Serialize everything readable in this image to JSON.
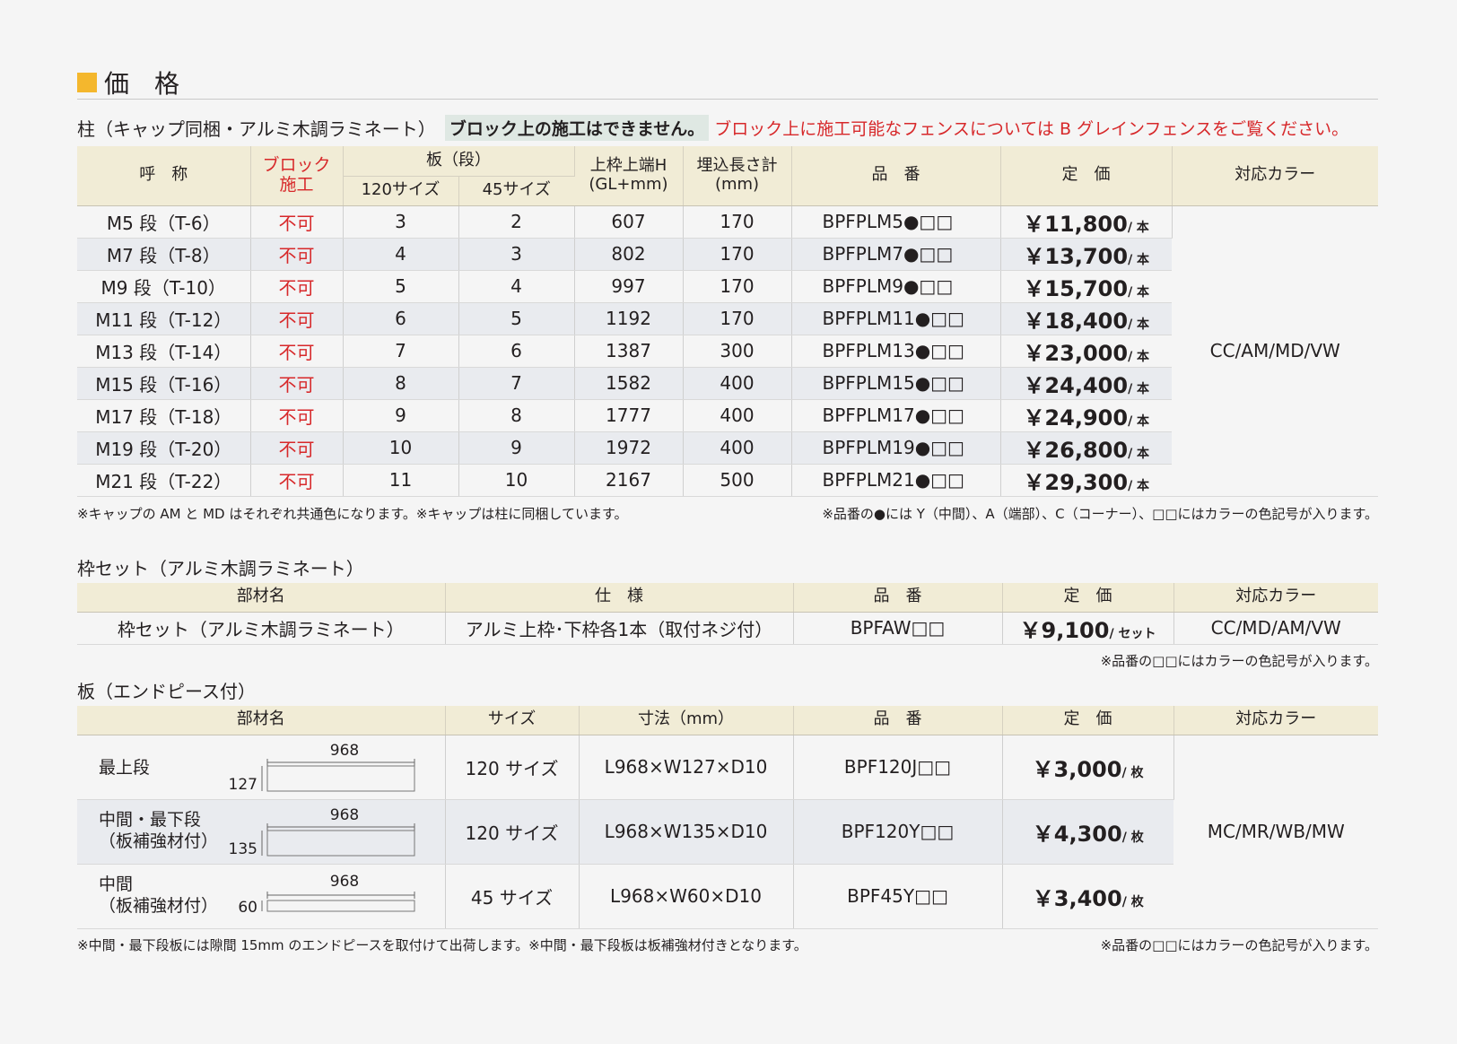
{
  "section_title": "価　格",
  "posts": {
    "heading": "柱（キャップ同梱・アルミ木調ラミネート）",
    "notice": "ブロック上の施工はできません。",
    "notice_red": "ブロック上に施工可能なフェンスについては B グレインフェンスをご覧ください。",
    "headers": {
      "name": "呼　称",
      "block": "ブロック\n施工",
      "plates": "板（段）",
      "size120": "120サイズ",
      "size45": "45サイズ",
      "height": "上枠上端H\n(GL+mm)",
      "bury": "埋込長さ計\n(mm)",
      "code": "品　番",
      "price": "定　価",
      "color": "対応カラー"
    },
    "rows": [
      {
        "name": "M5 段（T-6）",
        "block": "不可",
        "s120": "3",
        "s45": "2",
        "h": "607",
        "bury": "170",
        "code": "BPFPLM5●□□",
        "price": "￥11,800",
        "unit": "/ 本"
      },
      {
        "name": "M7 段（T-8）",
        "block": "不可",
        "s120": "4",
        "s45": "3",
        "h": "802",
        "bury": "170",
        "code": "BPFPLM7●□□",
        "price": "￥13,700",
        "unit": "/ 本"
      },
      {
        "name": "M9 段（T-10）",
        "block": "不可",
        "s120": "5",
        "s45": "4",
        "h": "997",
        "bury": "170",
        "code": "BPFPLM9●□□",
        "price": "￥15,700",
        "unit": "/ 本"
      },
      {
        "name": "M11 段（T-12）",
        "block": "不可",
        "s120": "6",
        "s45": "5",
        "h": "1192",
        "bury": "170",
        "code": "BPFPLM11●□□",
        "price": "￥18,400",
        "unit": "/ 本"
      },
      {
        "name": "M13 段（T-14）",
        "block": "不可",
        "s120": "7",
        "s45": "6",
        "h": "1387",
        "bury": "300",
        "code": "BPFPLM13●□□",
        "price": "￥23,000",
        "unit": "/ 本"
      },
      {
        "name": "M15 段（T-16）",
        "block": "不可",
        "s120": "8",
        "s45": "7",
        "h": "1582",
        "bury": "400",
        "code": "BPFPLM15●□□",
        "price": "￥24,400",
        "unit": "/ 本"
      },
      {
        "name": "M17 段（T-18）",
        "block": "不可",
        "s120": "9",
        "s45": "8",
        "h": "1777",
        "bury": "400",
        "code": "BPFPLM17●□□",
        "price": "￥24,900",
        "unit": "/ 本"
      },
      {
        "name": "M19 段（T-20）",
        "block": "不可",
        "s120": "10",
        "s45": "9",
        "h": "1972",
        "bury": "400",
        "code": "BPFPLM19●□□",
        "price": "￥26,800",
        "unit": "/ 本"
      },
      {
        "name": "M21 段（T-22）",
        "block": "不可",
        "s120": "11",
        "s45": "10",
        "h": "2167",
        "bury": "500",
        "code": "BPFPLM21●□□",
        "price": "￥29,300",
        "unit": "/ 本"
      }
    ],
    "colors": "CC/AM/MD/VW",
    "note_left": "※キャップの AM と MD はそれぞれ共通色になります。※キャップは柱に同梱しています。",
    "note_right": "※品番の●には Y（中間）、A（端部）、C（コーナー）、□□にはカラーの色記号が入ります。"
  },
  "frame": {
    "heading": "枠セット（アルミ木調ラミネート）",
    "headers": {
      "part": "部材名",
      "spec": "仕　様",
      "code": "品　番",
      "price": "定　価",
      "color": "対応カラー"
    },
    "row": {
      "part": "枠セット（アルミ木調ラミネート）",
      "spec": "アルミ上枠･下枠各1本（取付ネジ付）",
      "code": "BPFAW□□",
      "price": "￥9,100",
      "unit": "/ セット",
      "color": "CC/MD/AM/VW"
    },
    "note": "※品番の□□にはカラーの色記号が入ります。"
  },
  "boards": {
    "heading": "板（エンドピース付）",
    "headers": {
      "part": "部材名",
      "size": "サイズ",
      "dim": "寸法（mm）",
      "code": "品　番",
      "price": "定　価",
      "color": "対応カラー"
    },
    "rows": [
      {
        "name": "最上段",
        "width_label": "968",
        "height_label": "127",
        "size": "120 サイズ",
        "dim": "L968×W127×D10",
        "code": "BPF120J□□",
        "price": "￥3,000",
        "unit": "/ 枚"
      },
      {
        "name": "中間・最下段\n（板補強材付）",
        "width_label": "968",
        "height_label": "135",
        "size": "120 サイズ",
        "dim": "L968×W135×D10",
        "code": "BPF120Y□□",
        "price": "￥4,300",
        "unit": "/ 枚"
      },
      {
        "name": "中間\n（板補強材付）",
        "width_label": "968",
        "height_label": "60",
        "size": "45 サイズ",
        "dim": "L968×W60×D10",
        "code": "BPF45Y□□",
        "price": "￥3,400",
        "unit": "/ 枚"
      }
    ],
    "colors": "MC/MR/WB/MW",
    "note_left": "※中間・最下段板には隙間 15mm のエンドピースを取付けて出荷します。※中間・最下段板は板補強材付きとなります。",
    "note_right": "※品番の□□にはカラーの色記号が入ります。"
  }
}
